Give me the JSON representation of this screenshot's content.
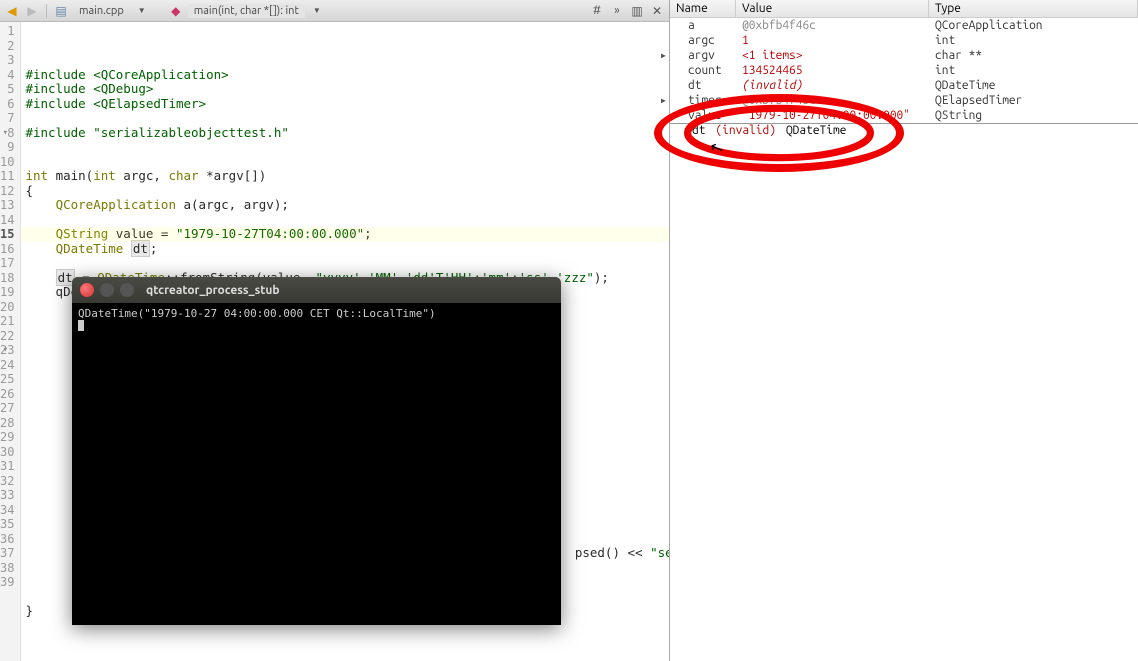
{
  "toolbar": {
    "file_tab": "main.cpp",
    "crumb": "main(int, char *[]): int",
    "toolbar2_hash": "#"
  },
  "code": {
    "lines": [
      {
        "n": 1,
        "html": "<span class='hl-pre'>#include</span> <span class='hl-inc'>&lt;QCoreApplication&gt;</span>"
      },
      {
        "n": 2,
        "html": "<span class='hl-pre'>#include</span> <span class='hl-inc'>&lt;QDebug&gt;</span>"
      },
      {
        "n": 3,
        "html": "<span class='hl-pre'>#include</span> <span class='hl-inc'>&lt;QElapsedTimer&gt;</span>"
      },
      {
        "n": 4,
        "html": ""
      },
      {
        "n": 5,
        "html": "<span class='hl-pre'>#include</span> <span class='hl-str'>\"serializableobjecttest.h\"</span>"
      },
      {
        "n": 6,
        "html": ""
      },
      {
        "n": 7,
        "html": ""
      },
      {
        "n": 8,
        "html": "<span class='hl-kw'>int</span> <span class='hl-id'>main</span>(<span class='hl-kw'>int</span> argc, <span class='hl-kw'>char</span> *argv[])"
      },
      {
        "n": 9,
        "html": "{"
      },
      {
        "n": 10,
        "html": "    <span class='hl-typ'>QCoreApplication</span> a(argc, argv);"
      },
      {
        "n": 11,
        "html": ""
      },
      {
        "n": 12,
        "html": "    <span class='hl-typ'>QString</span> value = <span class='hl-str'>\"1979-10-27T04:00:00.000\"</span>;"
      },
      {
        "n": 13,
        "html": "    <span class='hl-typ'>QDateTime</span> <span class='hl-var'>dt</span>;"
      },
      {
        "n": 14,
        "html": ""
      },
      {
        "n": 15,
        "html": "    <span class='hl-var'>dt</span> = <span class='hl-typ'>QDateTime</span>::fromString(value, <span class='hl-str'>\"yyyy'-'MM'-'dd'T'HH':'mm':'ss'.'zzz\"</span>);"
      },
      {
        "n": 16,
        "html": "    qDebug() &lt;&lt; <span class='hl-var'>dt</span>;"
      },
      {
        "n": 17,
        "html": ""
      },
      {
        "n": 18,
        "html": ""
      },
      {
        "n": 19,
        "html": ""
      },
      {
        "n": 20,
        "html": ""
      },
      {
        "n": 21,
        "html": ""
      },
      {
        "n": 22,
        "html": ""
      },
      {
        "n": 23,
        "html": ""
      },
      {
        "n": 24,
        "html": ""
      },
      {
        "n": 25,
        "html": ""
      },
      {
        "n": 26,
        "html": ""
      },
      {
        "n": 27,
        "html": ""
      },
      {
        "n": 28,
        "html": ""
      },
      {
        "n": 29,
        "html": ""
      },
      {
        "n": 30,
        "html": ""
      },
      {
        "n": 31,
        "html": ""
      },
      {
        "n": 32,
        "html": ""
      },
      {
        "n": 33,
        "html": ""
      },
      {
        "n": 34,
        "html": "                                                                         psed() &lt;&lt; <span class='hl-str'>\"se</span>"
      },
      {
        "n": 35,
        "html": ""
      },
      {
        "n": 36,
        "html": ""
      },
      {
        "n": 37,
        "html": ""
      },
      {
        "n": 38,
        "html": "}"
      },
      {
        "n": 39,
        "html": ""
      }
    ],
    "current_line": 15,
    "breakpoint_line": 18,
    "fold_lines": [
      8,
      23
    ]
  },
  "vars": {
    "headers": {
      "name": "Name",
      "value": "Value",
      "type": "Type"
    },
    "rows": [
      {
        "name": "a",
        "value": "@0xbfb4f46c",
        "type": "QCoreApplication",
        "gray": true
      },
      {
        "name": "argc",
        "value": "1",
        "type": "int",
        "red": true
      },
      {
        "name": "argv",
        "value": "<1 items>",
        "type": "char **",
        "red": true,
        "expand": true
      },
      {
        "name": "count",
        "value": "134524465",
        "type": "int",
        "red": true
      },
      {
        "name": "dt",
        "value": "(invalid)",
        "type": "QDateTime",
        "red": true,
        "italic": true
      },
      {
        "name": "timer",
        "value": "@0xbfb4f45c",
        "type": "QElapsedTimer",
        "gray": true,
        "expand": true
      },
      {
        "name": "value",
        "value": "\"1979-10-27T04:00:00.000\"",
        "type": "QString",
        "red": true
      }
    ]
  },
  "tooltip": {
    "name": "dt",
    "value": "(invalid)",
    "type": "QDateTime"
  },
  "terminal": {
    "title": "qtcreator_process_stub",
    "output": "QDateTime(\"1979-10-27 04:00:00.000 CET Qt::LocalTime\")"
  }
}
